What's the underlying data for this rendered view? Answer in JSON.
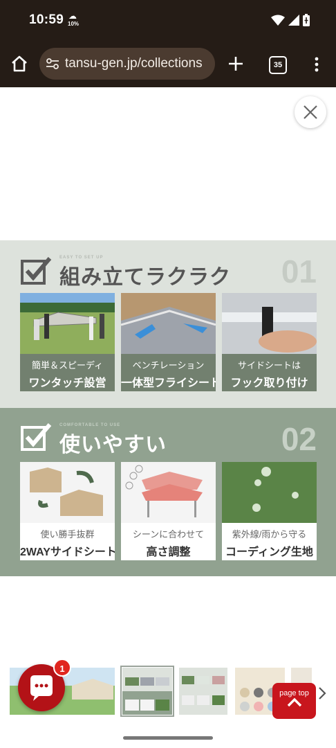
{
  "status_bar": {
    "time": "10:59",
    "weather_percent": "10%"
  },
  "browser": {
    "url": "tansu-gen.jp/collections",
    "tab_count": "35"
  },
  "section1": {
    "eng_label": "EASY TO SET UP",
    "title": "組み立てラクラク",
    "number": "01",
    "cards": [
      {
        "line1": "簡単＆スピーディ",
        "line2": "ワンタッチ設営"
      },
      {
        "line1": "ベンチレーション",
        "line2": "一体型フライシート"
      },
      {
        "line1": "サイドシートは",
        "line2": "フック取り付け"
      }
    ]
  },
  "section2": {
    "eng_label": "COMFORTABLE TO USE",
    "title": "使いやすい",
    "number": "02",
    "cards": [
      {
        "line1": "使い勝手抜群",
        "line2": "2WAYサイドシート"
      },
      {
        "line1": "シーンに合わせて",
        "line2": "高さ調整"
      },
      {
        "line1": "紫外線/雨から守る",
        "line2": "コーディング生地"
      }
    ]
  },
  "chat": {
    "badge": "1"
  },
  "page_top": {
    "label": "page top"
  }
}
